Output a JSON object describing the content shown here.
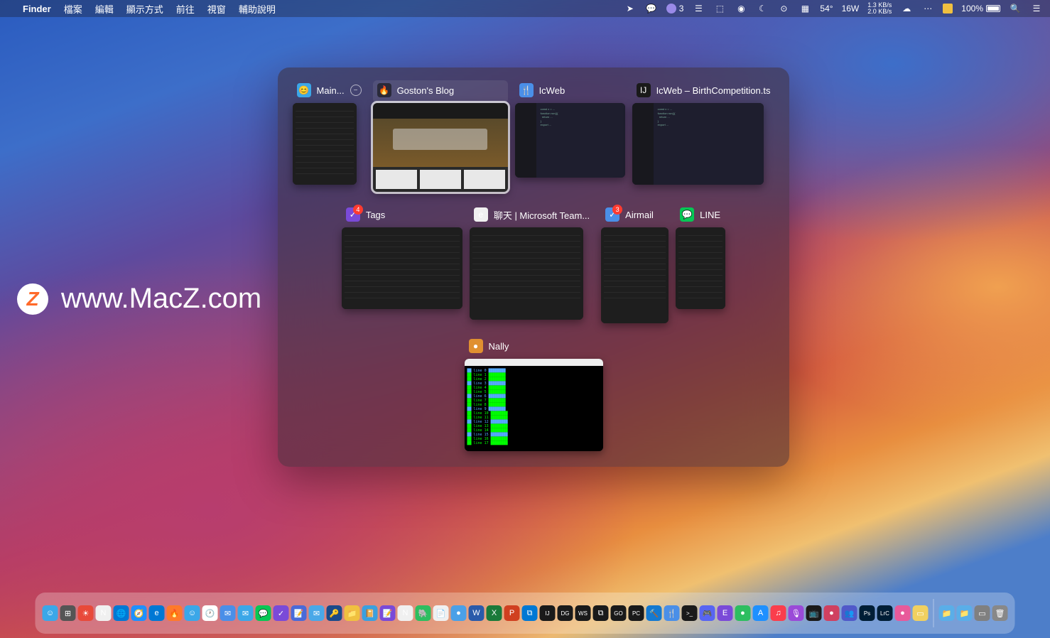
{
  "menubar": {
    "app_name": "Finder",
    "menus": [
      "檔案",
      "編輯",
      "顯示方式",
      "前往",
      "視窗",
      "輔助說明"
    ],
    "status": {
      "count_badge": "3",
      "temp": "54°",
      "watts": "16W",
      "net_up": "1.3 KB/s",
      "net_down": "2.0 KB/s",
      "battery": "100%"
    }
  },
  "watermark": {
    "logo_letter": "Z",
    "text": "www.MacZ.com"
  },
  "switcher": {
    "rows": [
      [
        {
          "id": "main",
          "label": "Main...",
          "icon_bg": "#3ba7e8",
          "icon_glyph": "😊",
          "thumb_w": 90,
          "thumb_h": 115,
          "close": true
        },
        {
          "id": "firefox",
          "label": "Goston's Blog",
          "icon_bg": "#2a2a3a",
          "icon_glyph": "🔥",
          "thumb_w": 190,
          "thumb_h": 125,
          "selected": true
        },
        {
          "id": "icweb",
          "label": "IcWeb",
          "icon_bg": "#4a8fe8",
          "icon_glyph": "🍴",
          "thumb_w": 155,
          "thumb_h": 105
        },
        {
          "id": "intellij",
          "label": "IcWeb – BirthCompetition.ts",
          "icon_bg": "#1a1a1a",
          "icon_glyph": "IJ",
          "thumb_w": 185,
          "thumb_h": 115
        }
      ],
      [
        {
          "id": "tags",
          "label": "Tags",
          "icon_bg": "#7a4ad8",
          "icon_glyph": "✓",
          "thumb_w": 170,
          "thumb_h": 115,
          "badge": "4"
        },
        {
          "id": "teams",
          "label": "聊天 | Microsoft Team...",
          "icon_bg": "#f0f0f0",
          "icon_glyph": "e",
          "thumb_w": 160,
          "thumb_h": 130
        },
        {
          "id": "airmail",
          "label": "Airmail",
          "icon_bg": "#4a8fe8",
          "icon_glyph": "✓",
          "thumb_w": 95,
          "thumb_h": 135,
          "badge": "3"
        },
        {
          "id": "line",
          "label": "LINE",
          "icon_bg": "#06c755",
          "icon_glyph": "💬",
          "thumb_w": 70,
          "thumb_h": 115
        }
      ],
      [
        {
          "id": "nally",
          "label": "Nally",
          "icon_bg": "#e09030",
          "icon_glyph": "●",
          "thumb_w": 195,
          "thumb_h": 130
        }
      ]
    ]
  },
  "dock": {
    "icons": [
      {
        "name": "finder",
        "bg": "#3ba7e8",
        "glyph": "☺"
      },
      {
        "name": "launchpad",
        "bg": "#555",
        "glyph": "⊞"
      },
      {
        "name": "app1",
        "bg": "#e84a3a",
        "glyph": "☀"
      },
      {
        "name": "notion",
        "bg": "#f0f0f0",
        "glyph": "N"
      },
      {
        "name": "edge",
        "bg": "#0078d4",
        "glyph": "🌐"
      },
      {
        "name": "safari",
        "bg": "#1e90ff",
        "glyph": "🧭"
      },
      {
        "name": "edge2",
        "bg": "#0078d4",
        "glyph": "e"
      },
      {
        "name": "firefox",
        "bg": "#ff7a2a",
        "glyph": "🔥"
      },
      {
        "name": "app-face",
        "bg": "#3ba7e8",
        "glyph": "☺"
      },
      {
        "name": "clock",
        "bg": "#fff",
        "glyph": "🕐"
      },
      {
        "name": "airmail",
        "bg": "#4a8fe8",
        "glyph": "✉"
      },
      {
        "name": "mail",
        "bg": "#3ba7e8",
        "glyph": "✉"
      },
      {
        "name": "line",
        "bg": "#06c755",
        "glyph": "💬"
      },
      {
        "name": "things",
        "bg": "#7a4ad8",
        "glyph": "✓"
      },
      {
        "name": "notes",
        "bg": "#4a6ad8",
        "glyph": "📝"
      },
      {
        "name": "spark",
        "bg": "#4aa8e8",
        "glyph": "✉"
      },
      {
        "name": "1pass",
        "bg": "#1a4a8a",
        "glyph": "🔑"
      },
      {
        "name": "folder1",
        "bg": "#f0c040",
        "glyph": "📁"
      },
      {
        "name": "day1",
        "bg": "#3aa0e0",
        "glyph": "📔"
      },
      {
        "name": "bear",
        "bg": "#7a4ad8",
        "glyph": "📝"
      },
      {
        "name": "notion2",
        "bg": "#f0f0f0",
        "glyph": "N"
      },
      {
        "name": "evernote",
        "bg": "#2dbe60",
        "glyph": "🐘"
      },
      {
        "name": "drafts",
        "bg": "#f0f0f0",
        "glyph": "📄"
      },
      {
        "name": "app-blue",
        "bg": "#4aa0e8",
        "glyph": "●"
      },
      {
        "name": "word",
        "bg": "#2a5aaa",
        "glyph": "W"
      },
      {
        "name": "excel",
        "bg": "#1a7a3a",
        "glyph": "X"
      },
      {
        "name": "ppt",
        "bg": "#d04020",
        "glyph": "P"
      },
      {
        "name": "vscode",
        "bg": "#0078d4",
        "glyph": "⧉"
      },
      {
        "name": "intellij",
        "bg": "#1a1a1a",
        "glyph": "IJ"
      },
      {
        "name": "datagrip",
        "bg": "#1a1a1a",
        "glyph": "DG"
      },
      {
        "name": "webstorm",
        "bg": "#1a1a1a",
        "glyph": "WS"
      },
      {
        "name": "appcode",
        "bg": "#1a1a1a",
        "glyph": "⧉"
      },
      {
        "name": "goland",
        "bg": "#1a1a1a",
        "glyph": "GO"
      },
      {
        "name": "pycharm",
        "bg": "#1a1a1a",
        "glyph": "PC"
      },
      {
        "name": "xcode",
        "bg": "#1479d0",
        "glyph": "🔨"
      },
      {
        "name": "fork",
        "bg": "#4a8fe8",
        "glyph": "🍴"
      },
      {
        "name": "terminal",
        "bg": "#1a1a1a",
        "glyph": ">_"
      },
      {
        "name": "discord",
        "bg": "#5865f2",
        "glyph": "🎮"
      },
      {
        "name": "emacs",
        "bg": "#7a4ad8",
        "glyph": "E"
      },
      {
        "name": "app-green",
        "bg": "#2dbe60",
        "glyph": "●"
      },
      {
        "name": "appstore",
        "bg": "#1e90ff",
        "glyph": "A"
      },
      {
        "name": "music",
        "bg": "#fa3e4c",
        "glyph": "♫"
      },
      {
        "name": "podcast",
        "bg": "#9a4ad8",
        "glyph": "🎙"
      },
      {
        "name": "tv",
        "bg": "#1a1a1a",
        "glyph": "📺"
      },
      {
        "name": "app-red",
        "bg": "#d04060",
        "glyph": "●"
      },
      {
        "name": "teams",
        "bg": "#5059c9",
        "glyph": "👥"
      },
      {
        "name": "ps",
        "bg": "#001e36",
        "glyph": "Ps"
      },
      {
        "name": "lrc",
        "bg": "#001e36",
        "glyph": "LrC"
      },
      {
        "name": "app-pink",
        "bg": "#e85a9a",
        "glyph": "●"
      },
      {
        "name": "app-card",
        "bg": "#f0d060",
        "glyph": "▭"
      }
    ],
    "separator_after": 49,
    "tail": [
      {
        "name": "folder-blue",
        "bg": "#5aaee8",
        "glyph": "📁"
      },
      {
        "name": "folder-blue2",
        "bg": "#5aaee8",
        "glyph": "📁"
      },
      {
        "name": "screenshot",
        "bg": "#808080",
        "glyph": "▭"
      },
      {
        "name": "trash",
        "bg": "#888",
        "glyph": "🗑"
      }
    ]
  }
}
